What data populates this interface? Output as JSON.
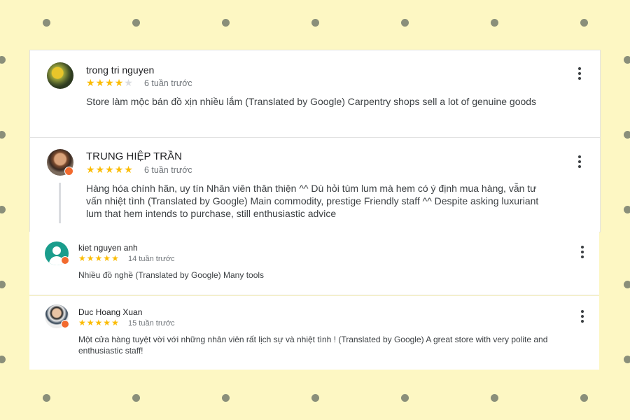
{
  "colors": {
    "background": "#fdf7c3",
    "dots": "#8a8f7a",
    "star": "#fbbc04",
    "badge": "#f26a2e"
  },
  "reviews": [
    {
      "name": "trong tri nguyen",
      "rating": 4,
      "max_rating": 5,
      "date": "6 tuần trước",
      "text": "Store làm mộc bán đồ xịn nhiều lắm (Translated by Google) Carpentry shops sell a lot of genuine goods",
      "avatar_icon": "yellow-flower-photo",
      "menu_icon": "more-vert-icon"
    },
    {
      "name": "TRUNG HIỆP TRẦN",
      "rating": 5,
      "max_rating": 5,
      "date": "6 tuần trước",
      "text": "Hàng hóa chính hãn, uy tín Nhân viên thân thiện ^^ Dù hỏi tùm lum mà hem có ý định mua hàng, vẫn tư vấn nhiệt tình (Translated by Google) Main commodity, prestige Friendly staff ^^ Despite asking luxuriant lum that hem intends to purchase, still enthusiastic advice",
      "avatar_icon": "man-portrait-photo",
      "menu_icon": "more-vert-icon"
    },
    {
      "name": "kiet nguyen anh",
      "rating": 5,
      "max_rating": 5,
      "date": "14 tuần trước",
      "text": "Nhiều đồ nghề (Translated by Google) Many tools",
      "avatar_icon": "default-user-icon",
      "menu_icon": "more-vert-icon"
    },
    {
      "name": "Duc Hoang Xuan",
      "rating": 5,
      "max_rating": 5,
      "date": "15 tuần trước",
      "text": "Một cửa hàng tuyệt vời với những nhân viên rất lịch sự và nhiệt tình ! (Translated by Google) A great store with very polite and enthusiastic staff!",
      "avatar_icon": "man-in-suit-photo",
      "menu_icon": "more-vert-icon"
    }
  ]
}
